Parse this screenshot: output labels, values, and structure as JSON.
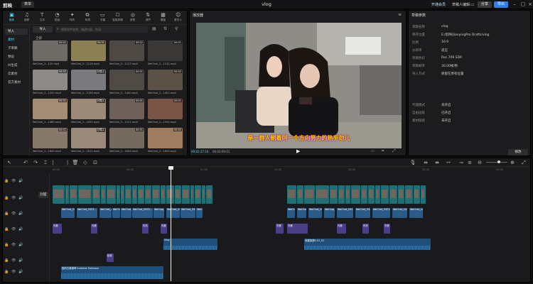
{
  "app": {
    "logo": "剪映",
    "menu": "菜单",
    "title": "vlog",
    "vip_label": "开通会员",
    "vip_label2": "草稿人编辑",
    "share": "分享",
    "export": "导出"
  },
  "tools": [
    {
      "label": "媒体",
      "icon": "▣"
    },
    {
      "label": "音频",
      "icon": "♫"
    },
    {
      "label": "文本",
      "icon": "T"
    },
    {
      "label": "贴纸",
      "icon": "◔"
    },
    {
      "label": "特效",
      "icon": "✦"
    },
    {
      "label": "转场",
      "icon": "⧉"
    },
    {
      "label": "字幕",
      "icon": "▭"
    },
    {
      "label": "智能剪辑",
      "icon": "☐"
    },
    {
      "label": "滤镜",
      "icon": "◎"
    },
    {
      "label": "调节",
      "icon": "⇅"
    },
    {
      "label": "模板",
      "icon": "▦"
    },
    {
      "label": "数字人",
      "icon": "☺"
    }
  ],
  "sidebar": [
    "导入",
    "素材",
    "子草稿",
    "预设",
    "AI生成",
    "云素材",
    "官方素材"
  ],
  "media": {
    "import_label": "导入",
    "search_placeholder": "搜索文件名称、描述内容、台词",
    "all_label": "全部"
  },
  "media_items": [
    {
      "cap": "WeChat_2...110.mp4",
      "dur": "00:01",
      "color": "#6e6a66"
    },
    {
      "cap": "WeChat_2...1114.mp4",
      "dur": "00:01",
      "color": "#8a7f55"
    },
    {
      "cap": "WeChat_2...1127.mp4",
      "dur": "00:02",
      "color": "#4d4844"
    },
    {
      "cap": "WeChat_2...1142.mp4",
      "dur": "00:01",
      "color": "#3a3836"
    },
    {
      "cap": "WeChat_2...1200.mp4",
      "dur": "00:02",
      "color": "#8d8a88"
    },
    {
      "cap": "WeChat_2...1338.mp4",
      "dur": "已导入",
      "color": "#7b7b7e"
    },
    {
      "cap": "WeChat_2...1400.mp4",
      "dur": "00:01",
      "color": "#504a44"
    },
    {
      "cap": "WeChat_2...1402.mp4",
      "dur": "00:02",
      "color": "#5c5146"
    },
    {
      "cap": "WeChat_2...1460.mp4",
      "dur": "00:01",
      "color": "#a48c74"
    },
    {
      "cap": "WeChat_2...1502.mp4",
      "dur": "已导入",
      "color": "#9c8a78"
    },
    {
      "cap": "WeChat_2...1511.mp4",
      "dur": "00:01",
      "color": "#6c6058"
    },
    {
      "cap": "WeChat_2...1540.mp4",
      "dur": "00:01",
      "color": "#7a5446"
    },
    {
      "cap": "WeChat_2...1600.mp4",
      "dur": "00:01",
      "color": "#86786a"
    },
    {
      "cap": "WeChat_2...1612.mp4",
      "dur": "已导入",
      "color": "#9a8a7c"
    },
    {
      "cap": "WeChat_2...1634.mp4",
      "dur": "00:01",
      "color": "#746a5e"
    },
    {
      "cap": "WeChat_2...1650.mp4",
      "dur": "00:01",
      "color": "#a07c60"
    }
  ],
  "player": {
    "title": "播放器",
    "subtitle": "是一群人朝着同一个方向努力的热乎劲儿",
    "time_current": "00:01:27:10",
    "time_total": "00:03:09:01"
  },
  "details": {
    "title": "草稿参数",
    "rows": [
      {
        "k": "草稿名称",
        "v": "vlog"
      },
      {
        "k": "保存位置",
        "v": "E:/剪映/JianyingPro Drafts/vlog"
      },
      {
        "k": "比例",
        "v": "16:9"
      },
      {
        "k": "分辨率",
        "v": "适应"
      },
      {
        "k": "草稿色彩",
        "v": "Rec.709 SDR"
      },
      {
        "k": "草稿帧率",
        "v": "30.00帧/秒"
      },
      {
        "k": "导入方式",
        "v": "保留在原有位置"
      },
      {
        "k": "代理模式",
        "v": "未开启"
      },
      {
        "k": "自由层级",
        "v": "已开启"
      },
      {
        "k": "素材链接",
        "v": "未开启"
      }
    ],
    "edit_label": "修改"
  },
  "timeline": {
    "ticks": [
      "00:00",
      "00:30",
      "01:00",
      "01:30",
      "02:00",
      "02:30",
      "03:00",
      "03:30"
    ],
    "cover_label": "封面",
    "text_clips": [
      "WeChat_2023...",
      "WeChat_2023...",
      "WeChat_2023...",
      "WeChat_2023...",
      "WeChat_2023...",
      "WeChat_2023...",
      "WeChat_2023..."
    ],
    "effect_labels": [
      "光晕",
      "光晕",
      "闪光",
      "光晕",
      "光晕"
    ],
    "audio_clips": [
      {
        "label": "Vlog"
      },
      {
        "label": "收藏视频0.01_52"
      }
    ],
    "sticker_label": "贴纸",
    "music_label": "国风古典钢琴 Summer Embrace"
  },
  "colors": {
    "accent": "#3ee3f7",
    "video_clip": "#1f6f74",
    "text_clip": "#2c5a86",
    "audio_clip": "#1f4f7a",
    "effect_clip": "#4a3f84"
  }
}
